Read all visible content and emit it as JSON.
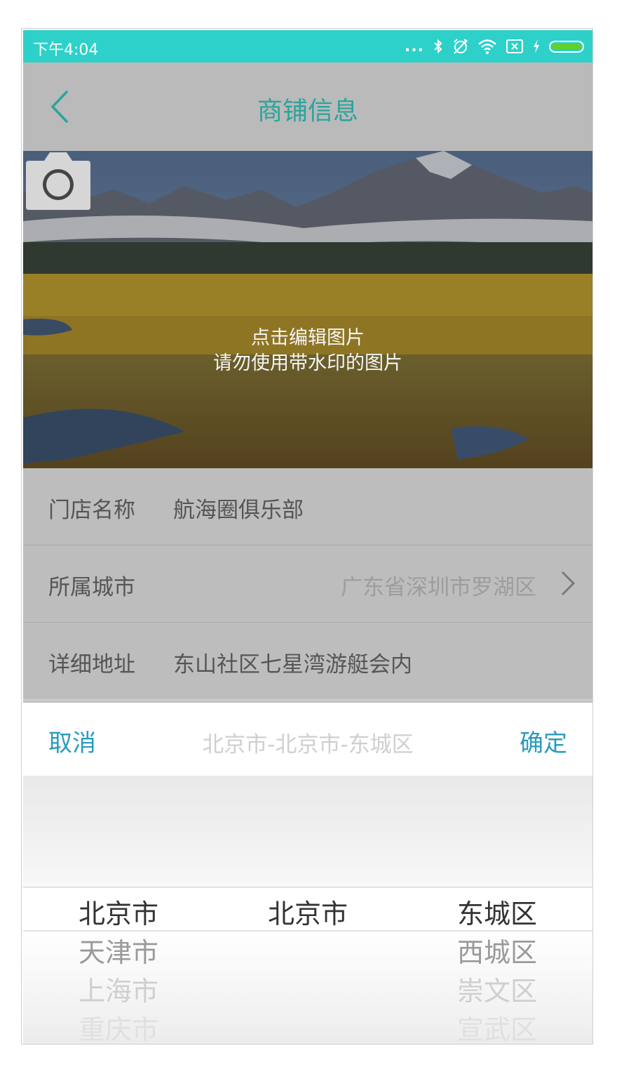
{
  "status_bar": {
    "time": "下午4:04",
    "dots": "..."
  },
  "navbar": {
    "title": "商铺信息"
  },
  "hero": {
    "line1": "点击编辑图片",
    "line2": "请勿使用带水印的图片"
  },
  "form": {
    "store_name": {
      "label": "门店名称",
      "value": "航海圈俱乐部"
    },
    "city": {
      "label": "所属城市",
      "value": "广东省深圳市罗湖区"
    },
    "address": {
      "label": "详细地址",
      "value": "东山社区七星湾游艇会内"
    }
  },
  "picker": {
    "cancel": "取消",
    "confirm": "确定",
    "current": "北京市-北京市-东城区",
    "provinces": [
      "北京市",
      "天津市",
      "上海市",
      "重庆市"
    ],
    "cities": [
      "北京市"
    ],
    "districts": [
      "东城区",
      "西城区",
      "崇文区",
      "宣武区"
    ]
  },
  "colors": {
    "status_bar": "#2dd1c9",
    "accent": "#2aa49c",
    "action": "#2a9bbd"
  }
}
